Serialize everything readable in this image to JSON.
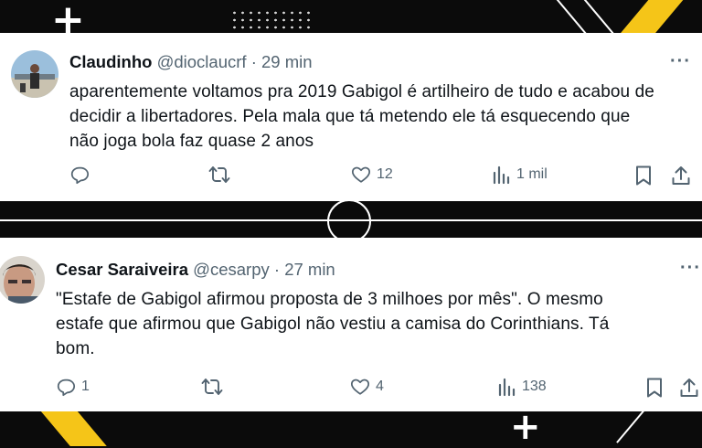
{
  "tweets": [
    {
      "name": "Claudinho",
      "handle": "@dioclaucrf",
      "separator": "·",
      "time": "29 min",
      "text_lines": [
        "aparentemente voltamos pra 2019 Gabigol é artilheiro de tudo e acabou de",
        "decidir a libertadores. Pela mala que tá metendo ele tá esquecendo que",
        "não joga bola faz quase 2 anos"
      ],
      "more": "···",
      "actions": {
        "reply_count": "",
        "retweet_count": "",
        "like_count": "12",
        "views_count": "1 mil"
      }
    },
    {
      "name": "Cesar Saraiveira",
      "handle": "@cesarpy",
      "separator": "·",
      "time": "27 min",
      "text_lines": [
        "\"Estafe de Gabigol afirmou proposta de 3 milhoes por mês\". O mesmo",
        "estafe que afirmou que Gabigol não vestiu a camisa do Corinthians. Tá",
        "bom."
      ],
      "more": "···",
      "actions": {
        "reply_count": "1",
        "retweet_count": "",
        "like_count": "4",
        "views_count": "138"
      }
    }
  ],
  "decor": {
    "plus_glyph": "+",
    "accent_color": "#f5c518"
  },
  "icons": [
    "reply-icon",
    "retweet-icon",
    "like-icon",
    "views-icon",
    "bookmark-icon",
    "share-icon"
  ]
}
